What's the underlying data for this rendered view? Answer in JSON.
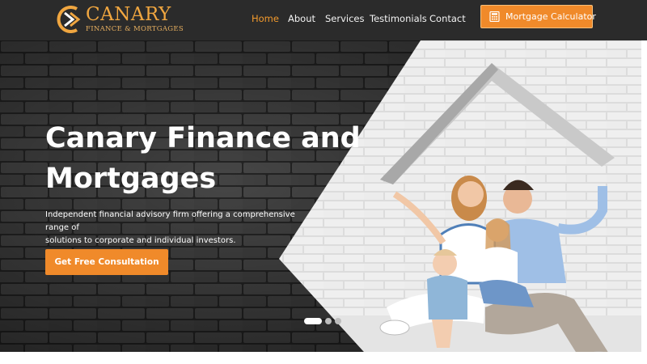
{
  "brand": {
    "name": "CANARY",
    "tagline": "FINANCE & MORTGAGES"
  },
  "nav": {
    "items": [
      {
        "label": "Home",
        "active": true
      },
      {
        "label": "About",
        "active": false
      },
      {
        "label": "Services",
        "active": false
      },
      {
        "label": "Testimonials",
        "active": false
      },
      {
        "label": "Contact",
        "active": false
      }
    ],
    "calculator_label": "Mortgage Calculator",
    "calculator_icon": "calculator-icon"
  },
  "hero": {
    "title_line1": "Canary Finance and",
    "title_line2": "Mortgages",
    "description_line1": "Independent financial advisory firm offering a comprehensive range of",
    "description_line2": "solutions to corporate and individual investors.",
    "cta_label": "Get Free Consultation",
    "slider": {
      "slide_count": 3,
      "active_slide": 1
    }
  },
  "colors": {
    "accent": "#f08a2a",
    "header_bg": "#2b2b2b",
    "nav_active": "#f39a2c",
    "logo_gold": "#f0a640"
  }
}
